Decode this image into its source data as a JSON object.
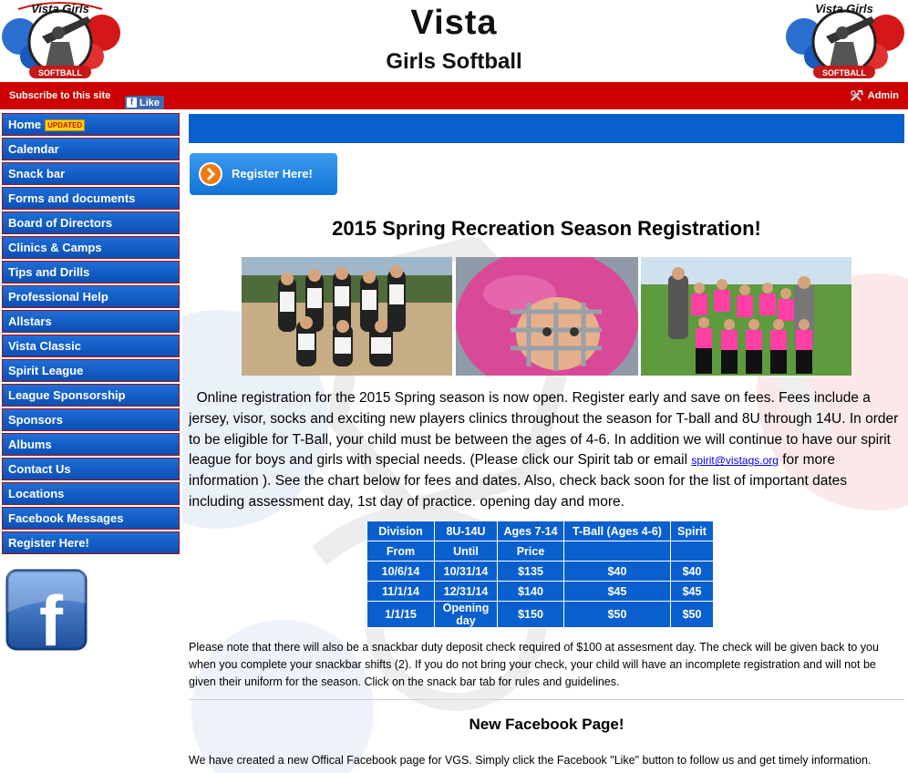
{
  "header": {
    "title_line1": "Vista",
    "title_line2": "Girls Softball",
    "logo_text_top": "Vista Girls",
    "logo_text_bottom": "SOFTBALL"
  },
  "topbar": {
    "subscribe": "Subscribe to this site",
    "like": "Like",
    "like_icon": "f",
    "admin": "Admin",
    "color": "#cc0000"
  },
  "nav": {
    "items": [
      "Home",
      "Calendar",
      "Snack bar",
      "Forms and documents",
      "Board of Directors",
      "Clinics & Camps",
      "Tips and Drills",
      "Professional Help",
      "Allstars",
      "Vista Classic",
      "Spirit League",
      "League Sponsorship",
      "Sponsors",
      "Albums",
      "Contact Us",
      "Locations",
      "Facebook Messages",
      "Register Here!"
    ],
    "home_badge": "UPDATED",
    "facebook_icon_letter": "f"
  },
  "main": {
    "register_button": "Register Here!",
    "season_title": "2015 Spring Recreation Season Registration!",
    "intro_part1": "Online registration for the 2015 Spring season is now open.  Register early and save on fees.  Fees include a jersey, visor, socks and exciting new players clinics throughout the season for T-ball and 8U through 14U.  In order to be eligible for T-Ball, your child must be between the ages of 4-6.  In addition we will continue to have our spirit league for boys and girls with special needs. (Please click our Spirit tab or email ",
    "intro_email": "spirit@vistags.org",
    "intro_part2": " for more information ).  See the chart below for fees and dates.  Also, check back soon for the list of important dates including assessment day, 1st day of practice. opening day and more.",
    "fee_table": {
      "header": [
        "Division",
        "8U-14U",
        "Ages 7-14",
        "T-Ball (Ages 4-6)",
        "Spirit"
      ],
      "subheader": [
        "From",
        "Until",
        "Price",
        "",
        ""
      ],
      "rows": [
        [
          "10/6/14",
          "10/31/14",
          "$135",
          "$40",
          "$40"
        ],
        [
          "11/1/14",
          "12/31/14",
          "$140",
          "$45",
          "$45"
        ],
        [
          "1/1/15",
          "Opening day",
          "$150",
          "$50",
          "$50"
        ]
      ]
    },
    "note": "Please note that there will also be a snackbar duty deposit check required of $100 at assesment day. The check will be given back to you when you complete your snackbar shifts (2).  If you do not bring your check, your child will have an incomplete registration and will not be given their uniform for the season.  Click on the snack bar tab for rules and guidelines.",
    "facebook_title": "New Facebook Page!",
    "facebook_text": "We have created a new Offical Facebook page for VGS.  Simply click the Facebook \"Like\" button to follow us and get timely information."
  },
  "colors": {
    "nav_blue": "#0b4fb4",
    "accent_red": "#cc0000",
    "table_blue": "#0a5fcf",
    "register_orange": "#f07a10",
    "jersey_pink": "#ff3fa4"
  }
}
